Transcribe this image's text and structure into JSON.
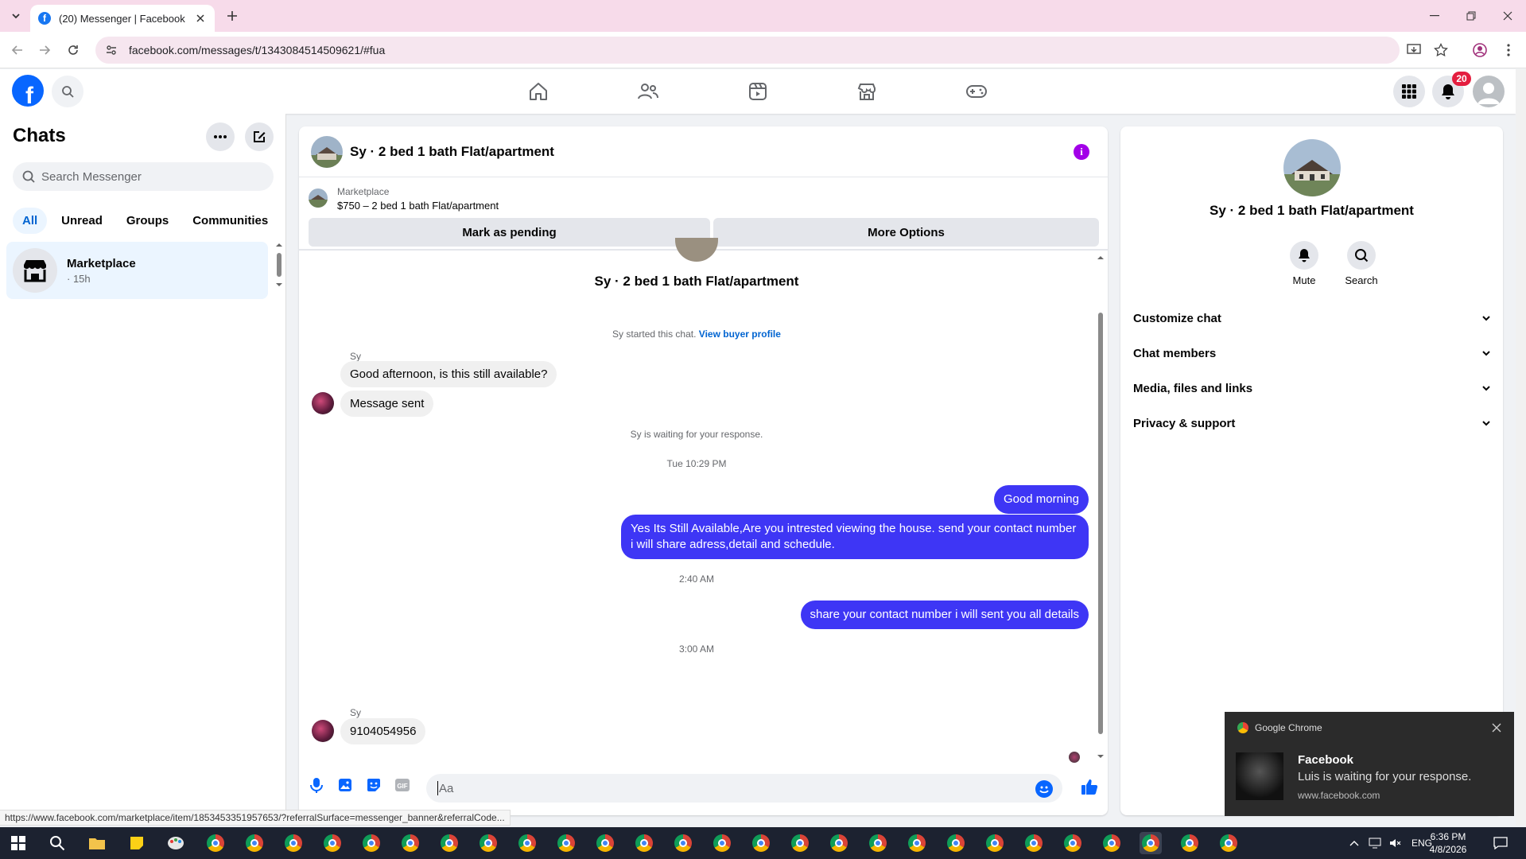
{
  "browser": {
    "tab_title": "(20) Messenger | Facebook",
    "url": "facebook.com/messages/t/1343084514509621/#fua"
  },
  "header": {
    "notification_count": "20"
  },
  "sidebar": {
    "title": "Chats",
    "search_placeholder": "Search Messenger",
    "filters": [
      "All",
      "Unread",
      "Groups",
      "Communities"
    ],
    "chat": {
      "name": "Marketplace",
      "meta": "· 15h"
    }
  },
  "conversation": {
    "title": "Sy · 2 bed 1 bath Flat/apartment",
    "banner": {
      "label": "Marketplace",
      "listing": "$750 – 2 bed 1 bath Flat/apartment",
      "mark_pending": "Mark as pending",
      "more_options": "More Options"
    },
    "center_name": "Sy · 2 bed 1 bath Flat/apartment",
    "started_text": "Sy started this chat.",
    "view_buyer": "View buyer profile",
    "sender1": "Sy",
    "msg1": "Good afternoon, is this still available?",
    "msg2": "Message sent",
    "waiting": "Sy is waiting for your response.",
    "time1": "Tue 10:29 PM",
    "out1": "Good morning",
    "out2": "Yes Its Still Available,Are you intrested viewing the house. send your contact number i will share adress,detail and schedule.",
    "time2": "2:40 AM",
    "out3": "share your contact number i will sent you all details",
    "time3": "3:00 AM",
    "sender2": "Sy",
    "msg3": "9104054956",
    "composer_placeholder": "Aa"
  },
  "right_panel": {
    "name": "Sy · 2 bed 1 bath Flat/apartment",
    "mute": "Mute",
    "search": "Search",
    "sections": [
      "Customize chat",
      "Chat members",
      "Media, files and links",
      "Privacy & support"
    ]
  },
  "toast": {
    "app": "Google Chrome",
    "title": "Facebook",
    "body": "Luis is waiting for your response.",
    "site": "www.facebook.com"
  },
  "status_url": "https://www.facebook.com/marketplace/item/1853453351957653/?referralSurface=messenger_banner&referralCode...",
  "taskbar": {
    "lang": "ENG",
    "time": "6:36 PM",
    "date": "4/8/2026"
  }
}
